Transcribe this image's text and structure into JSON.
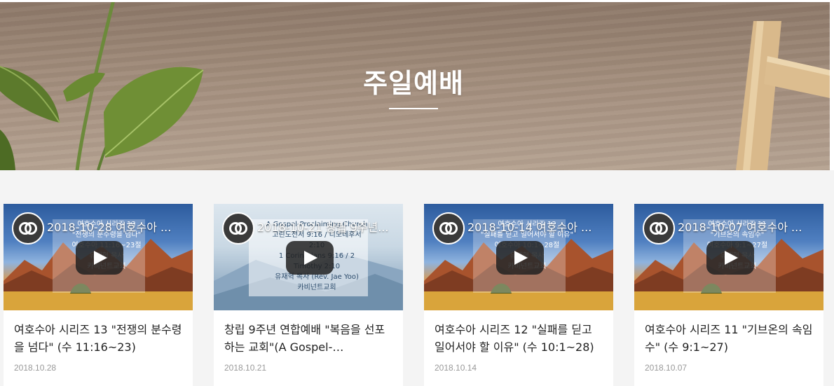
{
  "hero": {
    "title": "주일예배"
  },
  "cards": [
    {
      "video_title": "2018-10-28 여호수아 ...",
      "overlay_lines": [
        "여호수아 시리즈 13",
        "\"전쟁의 분수령을 넘다\"",
        "여호수아 11:16~23절",
        "유재혁 목사",
        "카비넌트교회"
      ],
      "title": "여호수아 시리즈 13 \"전쟁의 분수령을 넘다\" (수 11:16~23)",
      "date": "2018.10.28",
      "scene": "desert"
    },
    {
      "video_title": "2018-10-21 창립 9주년...",
      "overlay_lines": [
        "A Gospel-Proclaiming Church",
        "고린도전서 9:16 / 디모데후서 2:10",
        "1 Corinthians 9:16 / 2 Timothy 2:10",
        "유재혁 목사 (Rev. Jae Yoo)",
        "카비넌트교회"
      ],
      "title": "창립 9주년 연합예배 \"복음을 선포하는 교회\"(A Gospel-Proclaiming Church)",
      "date": "2018.10.21",
      "scene": "mist"
    },
    {
      "video_title": "2018-10-14 여호수아 ...",
      "overlay_lines": [
        "여호수아 시리즈 12",
        "\"실패를 딛고 일어서야 할 이유\"",
        "여호수아 10:1~28절",
        "유재혁 목사",
        "카비넌트교회"
      ],
      "title": "여호수아 시리즈 12 \"실패를 딛고 일어서야 할 이유\" (수 10:1~28)",
      "date": "2018.10.14",
      "scene": "desert"
    },
    {
      "video_title": "2018-10-07 여호수아 ...",
      "overlay_lines": [
        "여호수아 시리즈 11",
        "\"기브온의 속임수\"",
        "여호수아 9:1~27절",
        "유재혁 목사",
        "카비넌트교회"
      ],
      "title": "여호수아 시리즈 11 \"기브온의 속임수\" (수 9:1~27)",
      "date": "2018.10.07",
      "scene": "desert"
    }
  ],
  "icons": {
    "channel": "covenant-logo-icon",
    "play": "play-icon"
  },
  "colors": {
    "hero_text": "#ffffff",
    "card_title": "#222222",
    "card_date": "#999999",
    "page_bg": "#f4f4f4"
  }
}
